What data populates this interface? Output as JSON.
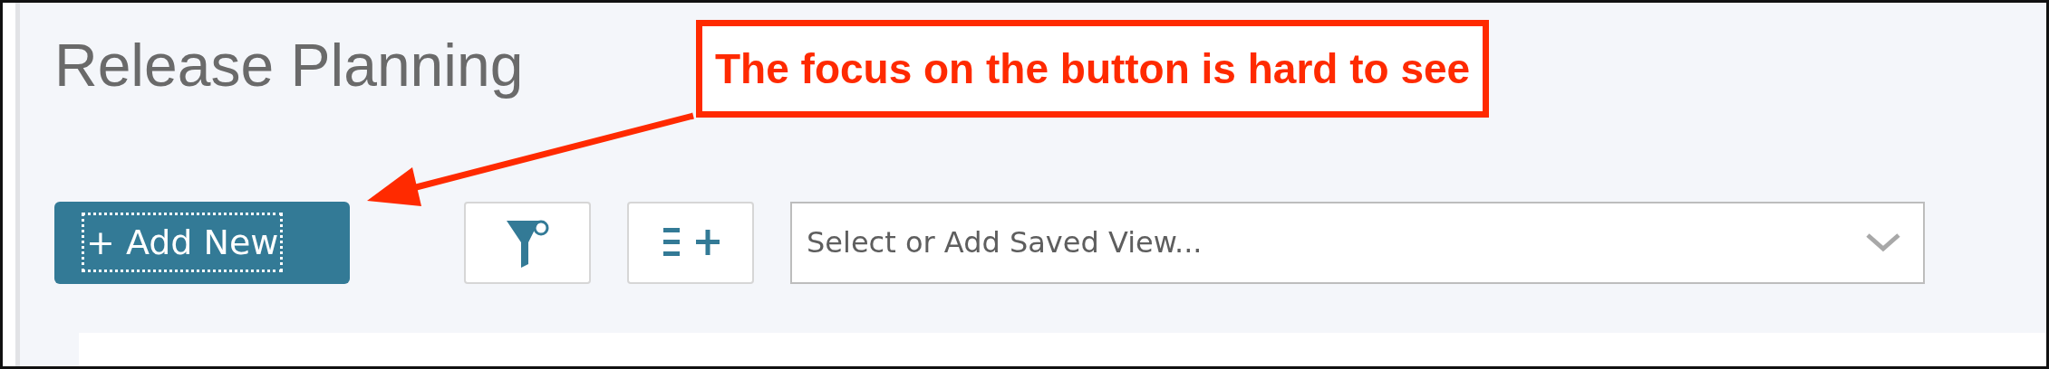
{
  "page": {
    "title": "Release Planning"
  },
  "annotation": {
    "text": "The focus on the button is hard to see"
  },
  "toolbar": {
    "add_button": {
      "label": "+ Add New",
      "focused": true
    },
    "saved_view": {
      "placeholder": "Select or Add Saved View..."
    }
  }
}
